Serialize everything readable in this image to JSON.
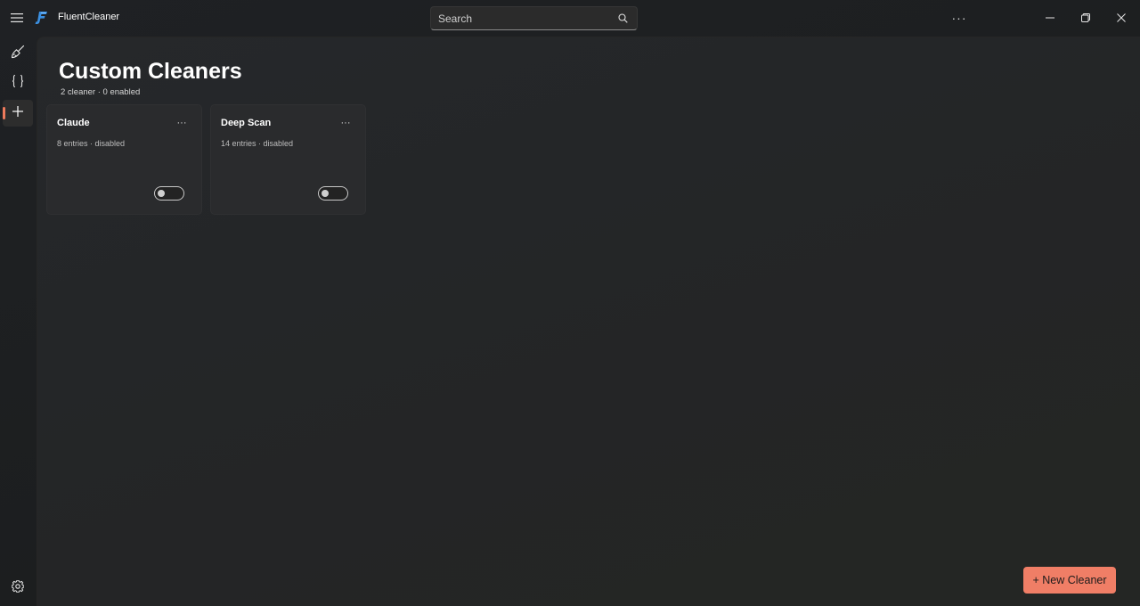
{
  "app": {
    "title": "FluentCleaner",
    "accent": "#ee7a5c",
    "button_color": "#f07e66"
  },
  "titlebar": {
    "menu_icon": "hamburger-icon",
    "search_placeholder": "Search",
    "more_label": "···",
    "caption_buttons": [
      "minimize-icon",
      "restore-icon",
      "close-icon"
    ]
  },
  "nav": {
    "items": [
      {
        "icon": "broom-icon"
      },
      {
        "icon": "braces-icon"
      },
      {
        "icon": "plus-icon",
        "selected": true
      }
    ],
    "footer": {
      "icon": "gear-icon"
    }
  },
  "page": {
    "title": "Custom Cleaners",
    "subtitle": "2 cleaner · 0 enabled"
  },
  "cards": [
    {
      "name": "Claude",
      "meta": "8 entries · disabled",
      "menu": "···",
      "enabled": false
    },
    {
      "name": "Deep Scan",
      "meta": "14 entries · disabled",
      "menu": "···",
      "enabled": false
    }
  ],
  "actions": {
    "new_cleaner_label": "+ New Cleaner"
  }
}
